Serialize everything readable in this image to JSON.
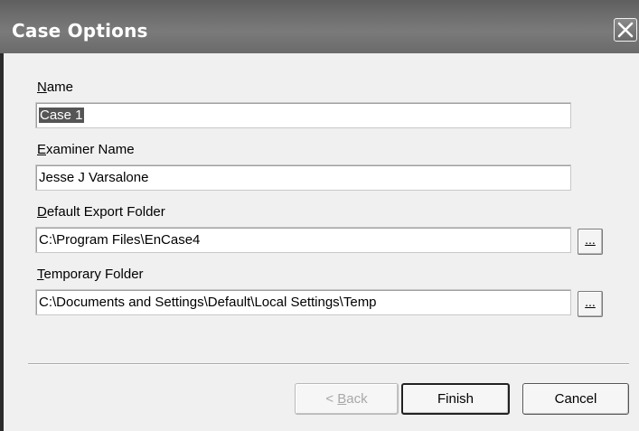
{
  "dialog": {
    "title": "Case Options",
    "close_icon": "close-icon"
  },
  "fields": {
    "name": {
      "label_key": "N",
      "label_rest": "ame",
      "value": "Case 1"
    },
    "examiner": {
      "label_key": "E",
      "label_rest": "xaminer Name",
      "value": "Jesse J Varsalone"
    },
    "export_folder": {
      "label_key": "D",
      "label_rest": "efault Export Folder",
      "value": "C:\\Program Files\\EnCase4",
      "browse_label": "..."
    },
    "temp_folder": {
      "label_key": "T",
      "label_rest": "emporary Folder",
      "value": "C:\\Documents and Settings\\Default\\Local Settings\\Temp",
      "browse_label": "..."
    }
  },
  "buttons": {
    "back_prefix": "< ",
    "back_key": "B",
    "back_rest": "ack",
    "finish": "Finish",
    "cancel": "Cancel"
  },
  "colors": {
    "titlebar": "#6e6e6e",
    "selection": "#555555"
  }
}
